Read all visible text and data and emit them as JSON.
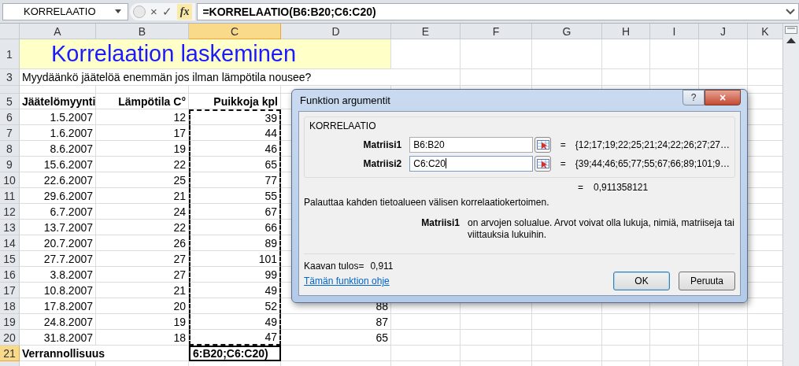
{
  "formula_bar": {
    "name_box": "KORRELAATIO",
    "cancel": "×",
    "enter": "✓",
    "function": "fx",
    "formula": "=KORRELAATIO(B6:B20;C6:C20)"
  },
  "columns": [
    {
      "label": "A",
      "selected": false
    },
    {
      "label": "B",
      "selected": false
    },
    {
      "label": "C",
      "selected": true
    },
    {
      "label": "D",
      "selected": false
    },
    {
      "label": "E",
      "selected": false
    },
    {
      "label": "F",
      "selected": false
    },
    {
      "label": "G",
      "selected": false
    },
    {
      "label": "H",
      "selected": false
    },
    {
      "label": "I",
      "selected": false
    },
    {
      "label": "J",
      "selected": false
    },
    {
      "label": "K",
      "selected": false
    }
  ],
  "rows": [
    {
      "kind": "title",
      "number": "1",
      "selected": false,
      "text": "Korrelaation laskeminen"
    },
    {
      "kind": "note",
      "number": "3",
      "selected": false,
      "text": "Myydäänkö jäätelöä enemmän jos ilman lämpötila nousee?"
    },
    {
      "kind": "thin",
      "selected": false
    },
    {
      "kind": "header",
      "number": "5",
      "selected": false,
      "cells": [
        "Jäätelömyynti",
        "Lämpötila C°",
        "Puikkoja kpl"
      ]
    },
    {
      "kind": "data",
      "number": "6",
      "selected": false,
      "referenced": true,
      "cells": [
        "1.5.2007",
        "12",
        "39"
      ]
    },
    {
      "kind": "data",
      "number": "7",
      "selected": false,
      "referenced": true,
      "cells": [
        "1.6.2007",
        "17",
        "44"
      ]
    },
    {
      "kind": "data",
      "number": "8",
      "selected": false,
      "referenced": true,
      "cells": [
        "8.6.2007",
        "19",
        "46"
      ]
    },
    {
      "kind": "data",
      "number": "9",
      "selected": false,
      "referenced": true,
      "cells": [
        "15.6.2007",
        "22",
        "65"
      ]
    },
    {
      "kind": "data",
      "number": "10",
      "selected": false,
      "referenced": true,
      "cells": [
        "22.6.2007",
        "25",
        "77"
      ]
    },
    {
      "kind": "data",
      "number": "11",
      "selected": false,
      "referenced": true,
      "cells": [
        "29.6.2007",
        "21",
        "55"
      ]
    },
    {
      "kind": "data",
      "number": "12",
      "selected": false,
      "referenced": true,
      "cells": [
        "6.7.2007",
        "24",
        "67"
      ]
    },
    {
      "kind": "data",
      "number": "13",
      "selected": false,
      "referenced": true,
      "cells": [
        "13.7.2007",
        "22",
        "66"
      ]
    },
    {
      "kind": "data",
      "number": "14",
      "selected": false,
      "referenced": true,
      "cells": [
        "20.7.2007",
        "26",
        "89"
      ]
    },
    {
      "kind": "data",
      "number": "15",
      "selected": false,
      "referenced": true,
      "cells": [
        "27.7.2007",
        "27",
        "101"
      ]
    },
    {
      "kind": "data",
      "number": "16",
      "selected": false,
      "referenced": true,
      "cells": [
        "3.8.2007",
        "27",
        "99"
      ]
    },
    {
      "kind": "data",
      "number": "17",
      "selected": false,
      "referenced": true,
      "cells": [
        "10.8.2007",
        "21",
        "49"
      ]
    },
    {
      "kind": "data",
      "number": "18",
      "selected": false,
      "referenced": true,
      "cells": [
        "17.8.2007",
        "20",
        "52",
        "88"
      ]
    },
    {
      "kind": "data",
      "number": "19",
      "selected": false,
      "referenced": true,
      "cells": [
        "24.8.2007",
        "19",
        "49",
        "87"
      ]
    },
    {
      "kind": "data",
      "number": "20",
      "selected": false,
      "referenced": true,
      "cells": [
        "31.8.2007",
        "18",
        "47",
        "65"
      ]
    },
    {
      "kind": "total",
      "number": "21",
      "selected": true,
      "label": "Verrannollisuus",
      "formula": "6:B20;C6:C20)"
    },
    {
      "kind": "blank",
      "selected": false
    }
  ],
  "dialog": {
    "title": "Funktion argumentit",
    "help": "?",
    "close": "×",
    "function": "KORRELAATIO",
    "arguments": [
      {
        "label": "Matriisi1",
        "value": "B6:B20",
        "focused": false,
        "equals": "=",
        "preview": "{12;17;19;22;25;21;24;22;26;27;27…"
      },
      {
        "label": "Matriisi2",
        "value": "C6:C20",
        "focused": true,
        "equals": "=",
        "preview": "{39;44;46;65;77;55;67;66;89;101;9…"
      }
    ],
    "result_equals": "=",
    "result": "0,911358121",
    "description": "Palauttaa kahden tietoalueen välisen korrelaatiokertoimen.",
    "argument_help": {
      "name": "Matriisi1",
      "text": "on arvojen solualue. Arvot voivat olla lukuja, nimiä, matriiseja tai viittauksia lukuihin."
    },
    "formula_result_label": "Kaavan tulos=",
    "formula_result": "0,911",
    "help_link": "Tämän funktion ohje",
    "buttons": [
      {
        "label": "OK",
        "default": true
      },
      {
        "label": "Peruuta",
        "default": false
      }
    ]
  }
}
